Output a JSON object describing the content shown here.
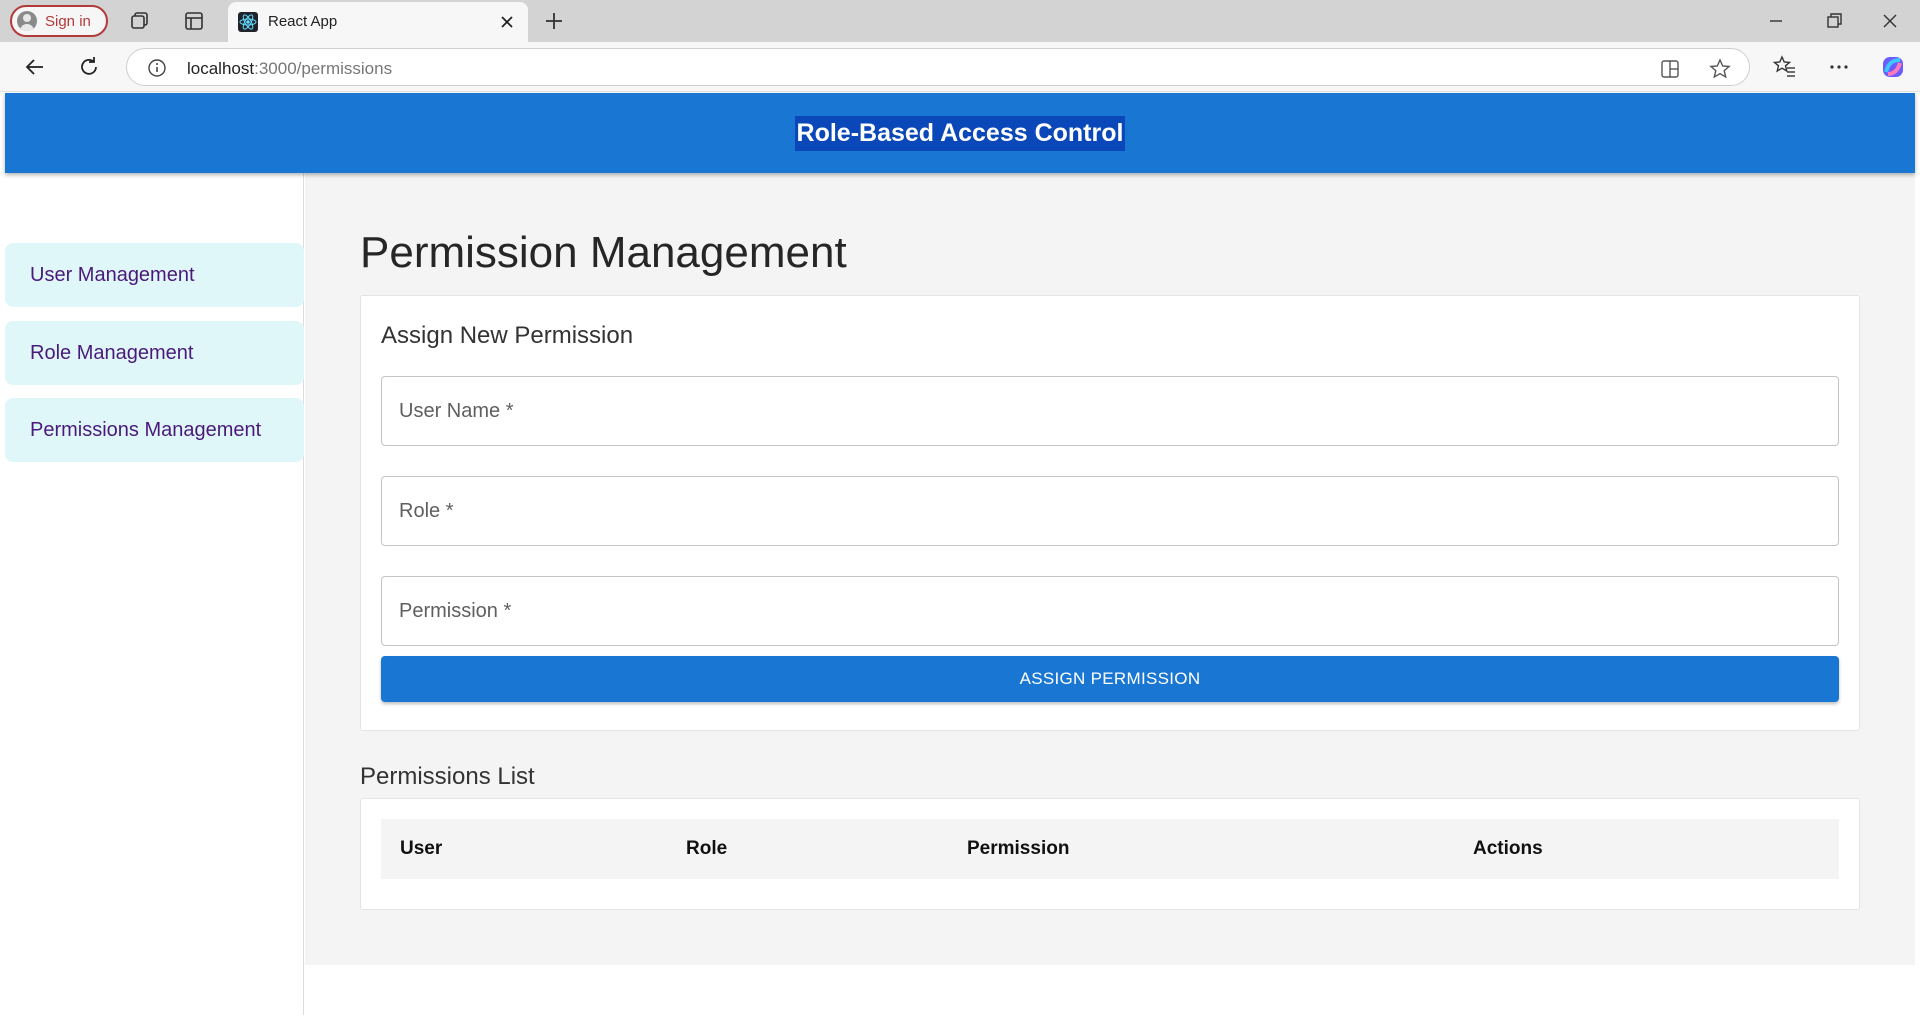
{
  "browser": {
    "signin_label": "Sign in",
    "tab_title": "React App",
    "url_host": "localhost",
    "url_rest": ":3000/permissions",
    "icons": [
      "profile-icon",
      "workspaces-icon",
      "tab-actions-icon",
      "react-favicon-icon",
      "close-tab-icon",
      "new-tab-icon",
      "minimize-icon",
      "restore-icon",
      "close-window-icon",
      "back-icon",
      "refresh-icon",
      "site-info-icon",
      "split-screen-icon",
      "favorite-star-icon",
      "favorites-icon",
      "more-icon",
      "copilot-icon"
    ]
  },
  "app": {
    "title": "Role-Based Access Control",
    "sidebar": {
      "items": [
        {
          "label": "User Management"
        },
        {
          "label": "Role Management"
        },
        {
          "label": "Permissions Management"
        }
      ]
    },
    "main": {
      "page_title": "Permission Management",
      "form": {
        "title": "Assign New Permission",
        "fields": [
          {
            "label": "User Name *",
            "value": ""
          },
          {
            "label": "Role *",
            "value": ""
          },
          {
            "label": "Permission *",
            "value": ""
          }
        ],
        "submit_label": "ASSIGN PERMISSION"
      },
      "list": {
        "title": "Permissions List",
        "columns": [
          "User",
          "Role",
          "Permission",
          "Actions"
        ],
        "rows": []
      }
    }
  },
  "colors": {
    "primary": "#1976d2",
    "title_highlight": "#0a47b8",
    "sidebar_item_bg": "#e0f7fa",
    "sidebar_item_text": "#4a1a7a",
    "main_bg": "#f4f4f4"
  }
}
